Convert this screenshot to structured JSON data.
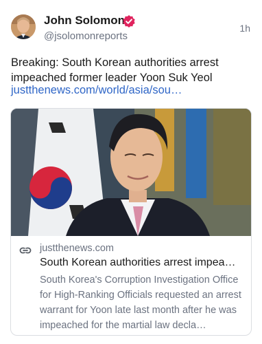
{
  "post": {
    "author_name": "John Solomon",
    "author_handle": "@jsolomonreports",
    "timestamp": "1h",
    "text": "Breaking: South Korean authorities arrest impeached former leader Yoon Suk Yeol",
    "link_text": "justthenews.com/world/asia/sou…"
  },
  "link_card": {
    "domain": "justthenews.com",
    "title": "South Korean authorities arrest impea…",
    "description": "South Korea's Corruption Investigation Office for High-Ranking Officials requested an arrest warrant for Yoon late last month after he was impeached for the martial law decla…"
  },
  "colors": {
    "link": "#2f66c7",
    "verified_badge": "#e0245e",
    "secondary_text": "#6b7280"
  }
}
